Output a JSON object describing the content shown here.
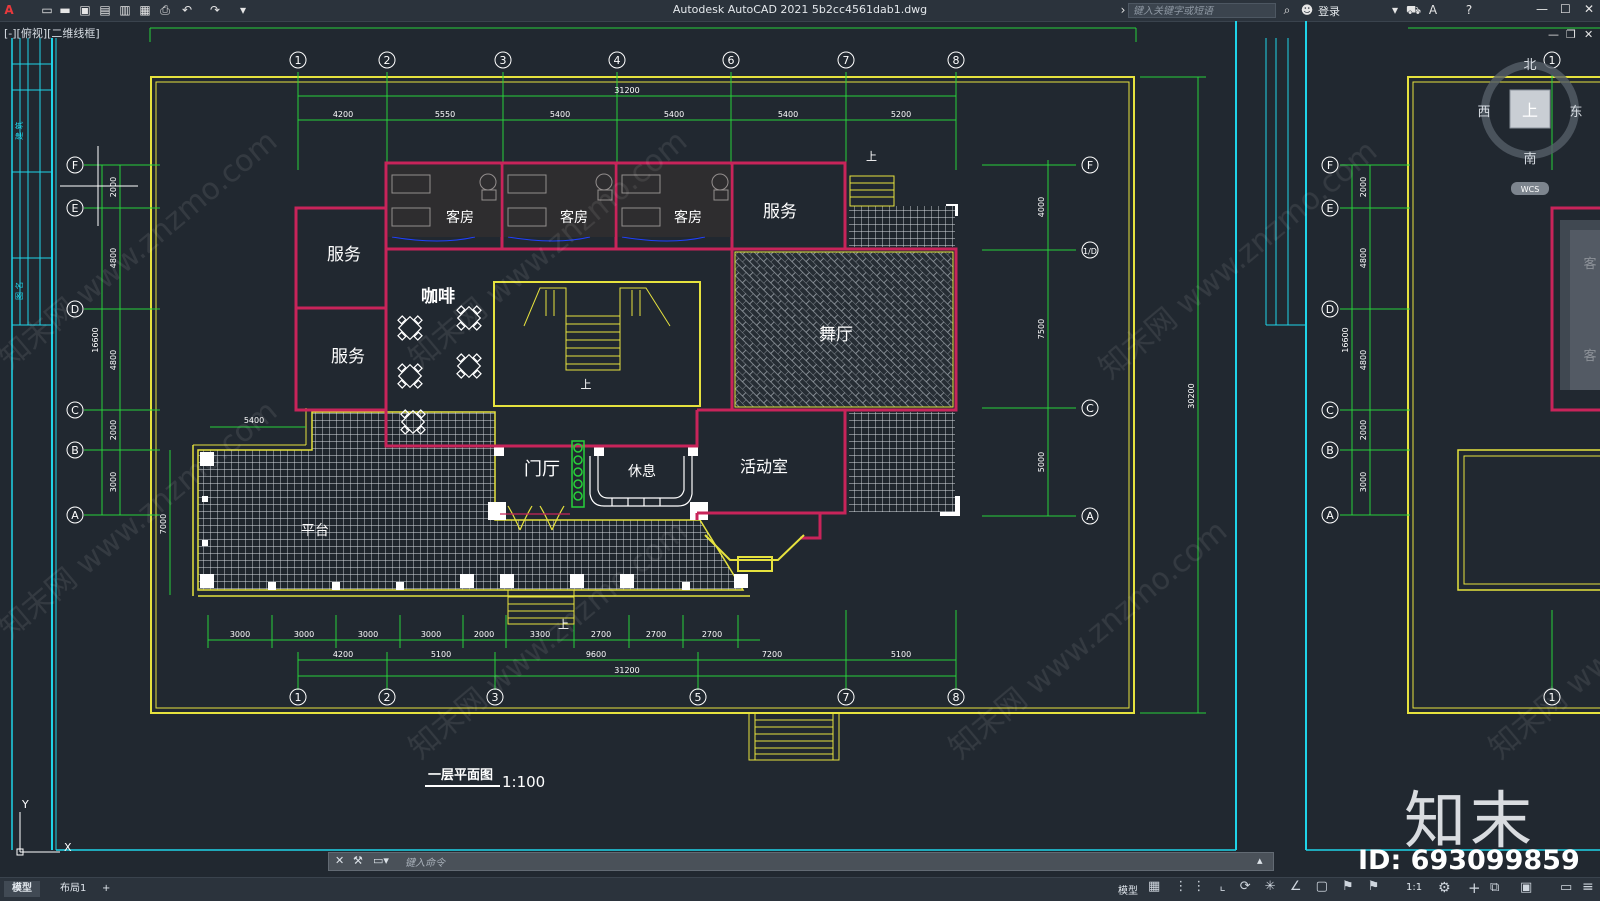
{
  "titlebar": {
    "app_title": "Autodesk AutoCAD 2021    5b2cc4561dab1.dwg",
    "search_placeholder": "键入关键字或短语",
    "login_label": "登录",
    "quick_access_icons": [
      "new-icon",
      "open-icon",
      "save-icon",
      "saveas-icon",
      "publish-icon",
      "plot-preview-icon",
      "print-icon",
      "undo-icon",
      "redo-icon",
      "dropdown-icon"
    ],
    "window_controls": [
      "minimize-icon",
      "maximize-icon",
      "close-icon"
    ]
  },
  "viewport": {
    "label": "[-][俯视][二维线框]"
  },
  "viewcube": {
    "north": "北",
    "south": "南",
    "east": "东",
    "west": "西",
    "top": "上",
    "wcs": "WCS"
  },
  "drawing": {
    "title": "一层平面图",
    "scale": "1:100",
    "axes_top": [
      "1",
      "2",
      "3",
      "4",
      "6",
      "7",
      "8"
    ],
    "axes_bottom": [
      "1",
      "2",
      "3",
      "5",
      "7",
      "8"
    ],
    "axes_left": [
      "F",
      "E",
      "D",
      "C",
      "B",
      "A"
    ],
    "axes_right": [
      "F",
      "1/D",
      "C",
      "A"
    ],
    "dims_top_total": "31200",
    "dims_top": [
      "4200",
      "5550",
      "5400",
      "5400",
      "5400",
      "5200"
    ],
    "dims_bottom_row1": [
      "3000",
      "3000",
      "3000",
      "3000",
      "2000",
      "3300",
      "2700",
      "2700",
      "2700"
    ],
    "dims_bottom_row2": [
      "4200",
      "5100",
      "9600",
      "7200",
      "5100"
    ],
    "dims_bottom_total": "31200",
    "dims_left": [
      "2000",
      "4800",
      "4800",
      "2000",
      "3000"
    ],
    "dims_left_total": "16600",
    "dim_platform": "5400",
    "dim_platform_depth": "7000",
    "dims_right": [
      "4000",
      "7500",
      "5000"
    ],
    "dim_right_total": "30200",
    "rooms": {
      "guest1": "客房",
      "guest2": "客房",
      "guest3": "客房",
      "service_top": "服务",
      "service_left1": "服务",
      "service_left2": "服务",
      "cafe": "咖啡",
      "dance": "舞厅",
      "lobby": "门厅",
      "rest": "休息",
      "activity": "活动室",
      "platform": "平台",
      "stair_up": "上",
      "stair_up2": "上",
      "stair_up3": "上"
    },
    "left_strip_text": [
      "建 筑",
      "图 名"
    ],
    "right_view_dims": [
      "2000",
      "4800",
      "4800",
      "2000",
      "3000",
      "16600"
    ],
    "right_view_axes": [
      "F",
      "E",
      "D",
      "C",
      "B",
      "A",
      "1",
      "1"
    ],
    "right_view_rooms": [
      "客",
      "客"
    ]
  },
  "watermark": "知末网 www.znzmo.com",
  "cmdline": {
    "placeholder": "键入命令"
  },
  "statusbar": {
    "tabs": [
      "模型",
      "布局1",
      "+"
    ],
    "model_label": "模型",
    "scale_label": "1:1"
  },
  "brand": {
    "name": "知末",
    "id": "ID: 693099859"
  },
  "colors": {
    "background": "#212830",
    "frame_yellow": "#e6e23e",
    "wall_magenta": "#c8245a",
    "dim_green": "#27d13a",
    "axis_cyan": "#1fd4e8",
    "white_lines": "#ffffff"
  }
}
